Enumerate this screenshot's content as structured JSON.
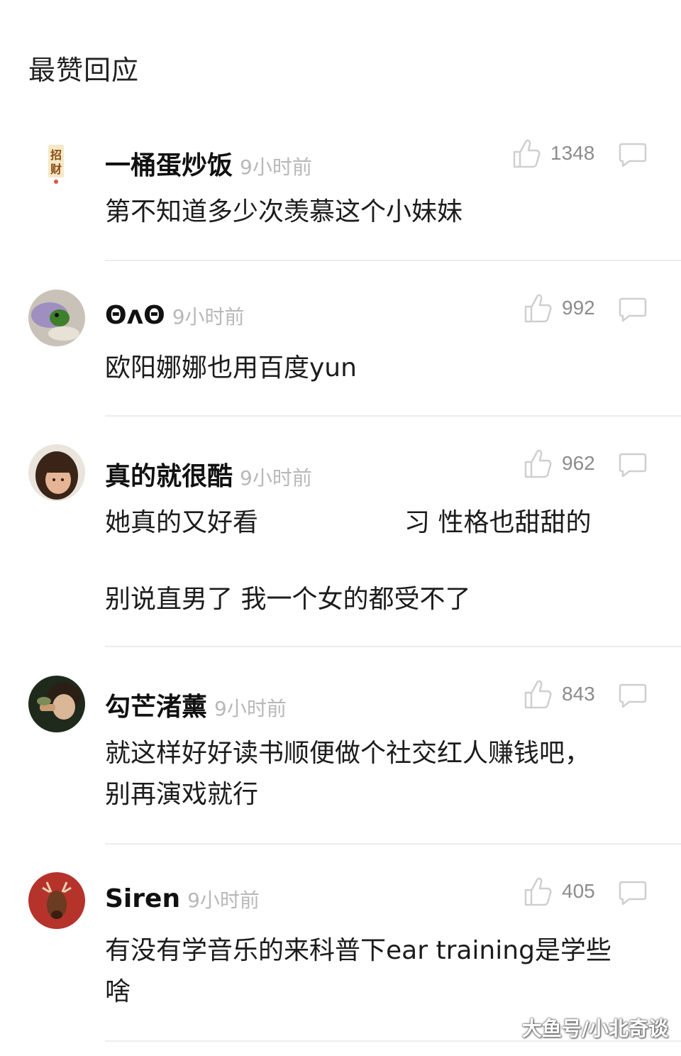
{
  "section_title": "最赞回应",
  "comments": [
    {
      "username": "一桶蛋炒饭",
      "time": "9小时前",
      "likes": "1348",
      "avatar_icon": "zhaocai-charm-icon",
      "lines": [
        "第不知道多少次羡慕这个小妹妹"
      ]
    },
    {
      "username": "ΘʌΘ",
      "time": "9小时前",
      "likes": "992",
      "avatar_icon": "frog-toy-icon",
      "lines": [
        "欧阳娜娜也用百度yun"
      ]
    },
    {
      "username": "真的就很酷",
      "time": "9小时前",
      "likes": "962",
      "avatar_icon": "girl-portrait-icon",
      "lines": [
        "她真的又好看",
        "习 性格也甜甜的",
        "别说直男了 我一个女的都受不了"
      ]
    },
    {
      "username": "勾芒渚薰",
      "time": "9小时前",
      "likes": "843",
      "avatar_icon": "boy-portrait-icon",
      "lines": [
        "就这样好好读书顺便做个社交红人赚钱吧，",
        "别再演戏就行"
      ]
    },
    {
      "username": "Siren",
      "time": "9小时前",
      "likes": "405",
      "avatar_icon": "deer-head-icon",
      "lines": [
        "有没有学音乐的来科普下ear training是学些",
        "啥"
      ]
    }
  ],
  "watermark": "大鱼号/小北奇谈",
  "colors": {
    "username": "#111111",
    "time": "#b8b8b8",
    "like_count": "#8c8c8c",
    "divider": "#ececec",
    "icon_stroke": "#cfcfcf"
  }
}
